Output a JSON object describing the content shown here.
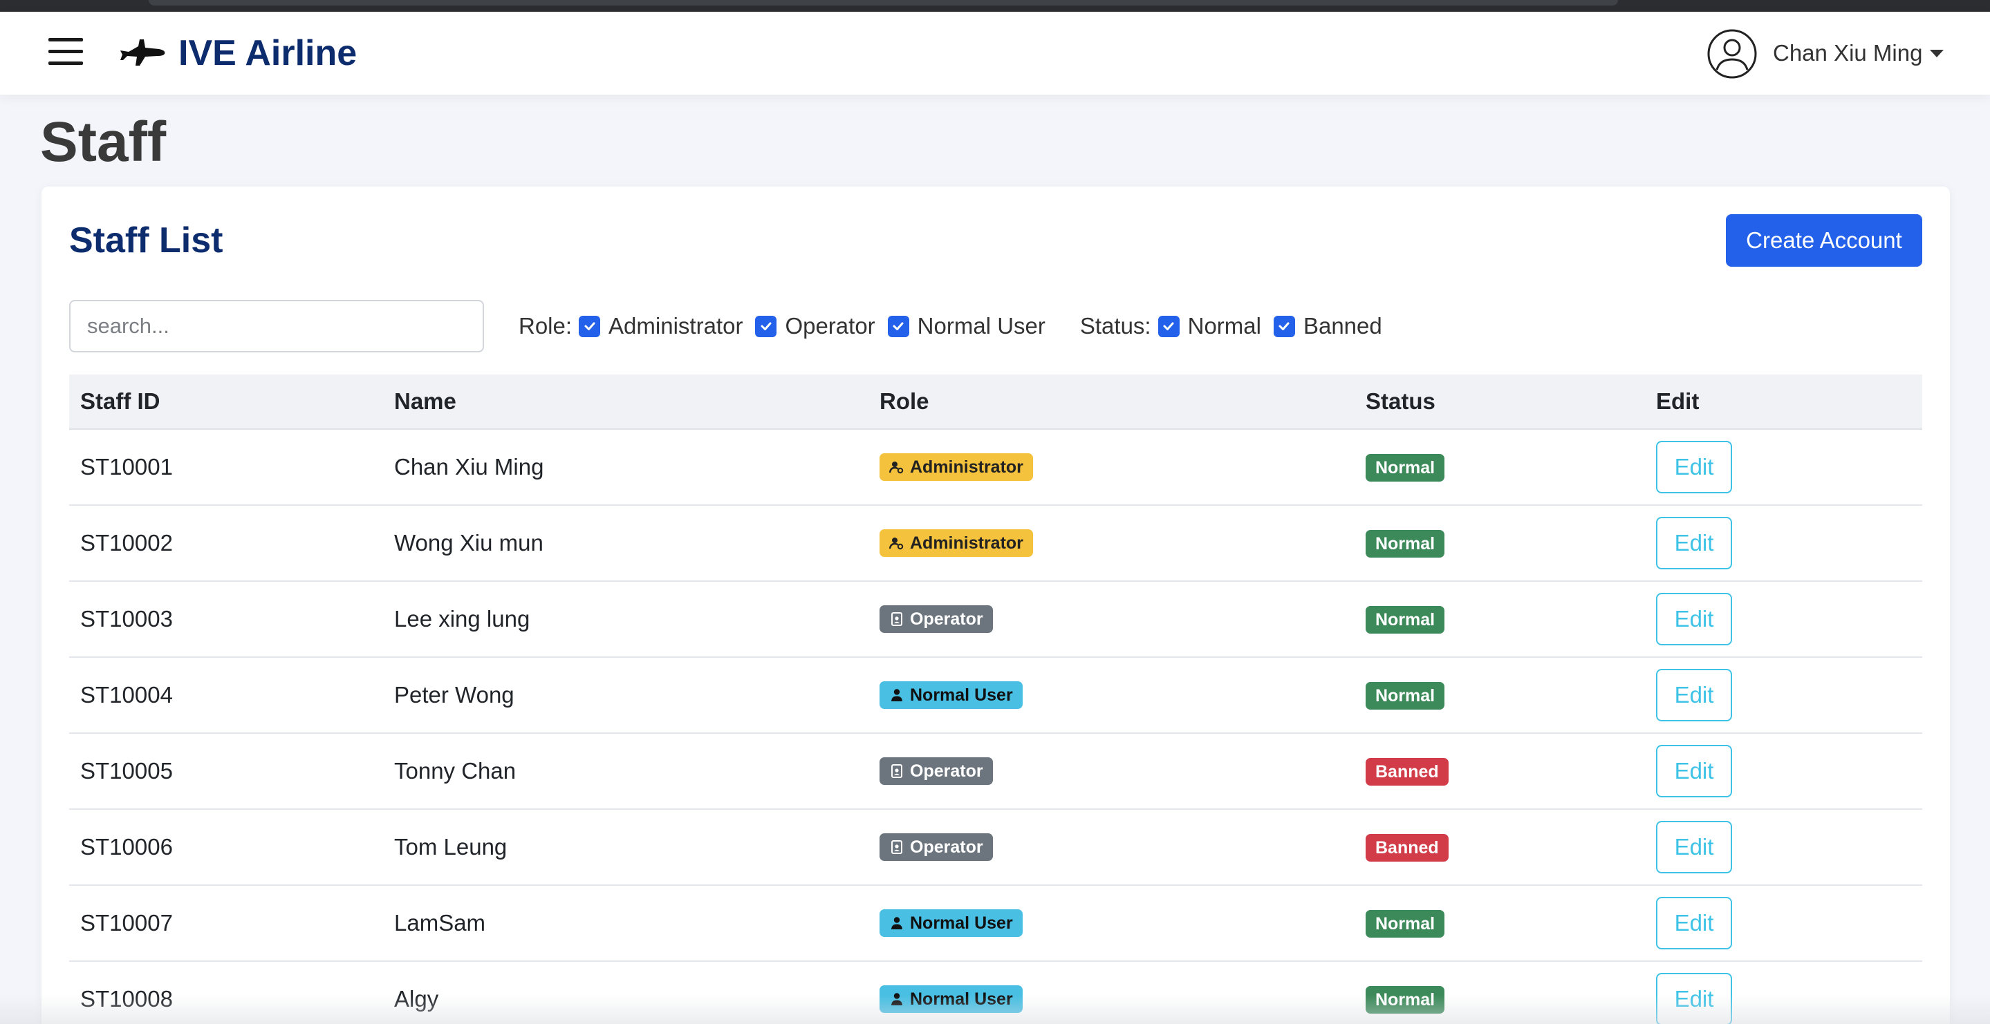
{
  "navbar": {
    "brand": "IVE Airline",
    "user_name": "Chan Xiu Ming"
  },
  "page": {
    "title": "Staff"
  },
  "card": {
    "title": "Staff List",
    "create_button": "Create Account"
  },
  "search": {
    "placeholder": "search..."
  },
  "filters": {
    "role_label": "Role:",
    "roles": [
      "Administrator",
      "Operator",
      "Normal User"
    ],
    "status_label": "Status:",
    "statuses": [
      "Normal",
      "Banned"
    ]
  },
  "table": {
    "headers": [
      "Staff ID",
      "Name",
      "Role",
      "Status",
      "Edit"
    ],
    "edit_label": "Edit",
    "rows": [
      {
        "id": "ST10001",
        "name": "Chan Xiu Ming",
        "role": "Administrator",
        "status": "Normal"
      },
      {
        "id": "ST10002",
        "name": "Wong Xiu mun",
        "role": "Administrator",
        "status": "Normal"
      },
      {
        "id": "ST10003",
        "name": "Lee xing lung",
        "role": "Operator",
        "status": "Normal"
      },
      {
        "id": "ST10004",
        "name": "Peter Wong",
        "role": "Normal User",
        "status": "Normal"
      },
      {
        "id": "ST10005",
        "name": "Tonny Chan",
        "role": "Operator",
        "status": "Banned"
      },
      {
        "id": "ST10006",
        "name": "Tom Leung",
        "role": "Operator",
        "status": "Banned"
      },
      {
        "id": "ST10007",
        "name": "LamSam",
        "role": "Normal User",
        "status": "Normal"
      },
      {
        "id": "ST10008",
        "name": "Algy",
        "role": "Normal User",
        "status": "Normal"
      }
    ]
  },
  "colors": {
    "brand": "#0d2c6e",
    "primary": "#2461ea",
    "administrator": "#f4c23c",
    "operator": "#6c757d",
    "normal_user": "#48bfe3",
    "status_normal": "#3c8a5a",
    "status_banned": "#d23b48",
    "edit_outline": "#3ec3e6"
  },
  "icons": {
    "menu": "hamburger-menu-icon",
    "logo": "airplane-icon",
    "avatar": "user-circle-icon",
    "administrator": "person-gear-icon",
    "operator": "person-badge-icon",
    "normal_user": "person-icon",
    "checkbox": "check-icon"
  }
}
